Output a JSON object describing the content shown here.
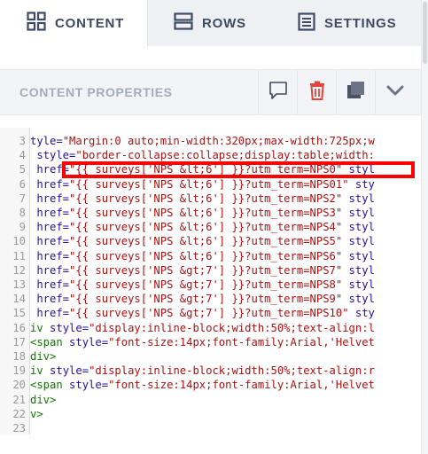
{
  "tabs": [
    {
      "label": "CONTENT",
      "icon": "grid-icon",
      "active": true
    },
    {
      "label": "ROWS",
      "icon": "rows-icon",
      "active": false
    },
    {
      "label": "SETTINGS",
      "icon": "settings-list-icon",
      "active": false
    }
  ],
  "properties_panel": {
    "title": "CONTENT PROPERTIES",
    "actions": [
      {
        "name": "comment-icon"
      },
      {
        "name": "trash-icon",
        "color": "#e0453a"
      },
      {
        "name": "duplicate-icon"
      },
      {
        "name": "chevron-down-icon"
      }
    ]
  },
  "editor": {
    "lines": [
      {
        "num": "3",
        "segments": [
          {
            "c": "k",
            "t": "tyle="
          },
          {
            "c": "s",
            "t": "\"Margin:0 auto;min-width:320px;max-width:725px;w"
          }
        ]
      },
      {
        "num": "4",
        "segments": [
          {
            "c": "k",
            "t": " style="
          },
          {
            "c": "s",
            "t": "\"border-collapse:collapse;display:table;width:"
          }
        ]
      },
      {
        "num": "5",
        "segments": [
          {
            "c": "k",
            "t": " href="
          },
          {
            "c": "s",
            "t": "\"{{ surveys['NPS &lt;6'] }}?utm_term=NPS0\""
          },
          {
            "c": "k",
            "t": " styl"
          }
        ]
      },
      {
        "num": "6",
        "segments": [
          {
            "c": "k",
            "t": " href="
          },
          {
            "c": "s",
            "t": "\"{{ surveys['NPS &lt;6'] }}?utm_term=NPS01\""
          },
          {
            "c": "k",
            "t": " sty"
          }
        ]
      },
      {
        "num": "7",
        "segments": [
          {
            "c": "k",
            "t": " href="
          },
          {
            "c": "s",
            "t": "\"{{ surveys['NPS &lt;6'] }}?utm_term=NPS2\""
          },
          {
            "c": "k",
            "t": " styl"
          }
        ]
      },
      {
        "num": "8",
        "segments": [
          {
            "c": "k",
            "t": " href="
          },
          {
            "c": "s",
            "t": "\"{{ surveys['NPS &lt;6'] }}?utm_term=NPS3\""
          },
          {
            "c": "k",
            "t": " styl"
          }
        ]
      },
      {
        "num": "9",
        "segments": [
          {
            "c": "k",
            "t": " href="
          },
          {
            "c": "s",
            "t": "\"{{ surveys['NPS &lt;6'] }}?utm_term=NPS4\""
          },
          {
            "c": "k",
            "t": " styl"
          }
        ]
      },
      {
        "num": "10",
        "segments": [
          {
            "c": "k",
            "t": " href="
          },
          {
            "c": "s",
            "t": "\"{{ surveys['NPS &lt;6'] }}?utm_term=NPS5\""
          },
          {
            "c": "k",
            "t": " styl"
          }
        ]
      },
      {
        "num": "11",
        "segments": [
          {
            "c": "k",
            "t": " href="
          },
          {
            "c": "s",
            "t": "\"{{ surveys['NPS &lt;6'] }}?utm_term=NPS6\""
          },
          {
            "c": "k",
            "t": " styl"
          }
        ]
      },
      {
        "num": "12",
        "segments": [
          {
            "c": "k",
            "t": " href="
          },
          {
            "c": "s",
            "t": "\"{{ surveys['NPS &gt;7'] }}?utm_term=NPS7\""
          },
          {
            "c": "k",
            "t": " styl"
          }
        ]
      },
      {
        "num": "13",
        "segments": [
          {
            "c": "k",
            "t": " href="
          },
          {
            "c": "s",
            "t": "\"{{ surveys['NPS &gt;7'] }}?utm_term=NPS8\""
          },
          {
            "c": "k",
            "t": " styl"
          }
        ]
      },
      {
        "num": "14",
        "segments": [
          {
            "c": "k",
            "t": " href="
          },
          {
            "c": "s",
            "t": "\"{{ surveys['NPS &gt;7'] }}?utm_term=NPS9\""
          },
          {
            "c": "k",
            "t": " styl"
          }
        ]
      },
      {
        "num": "15",
        "segments": [
          {
            "c": "k",
            "t": " href="
          },
          {
            "c": "s",
            "t": "\"{{ surveys['NPS &gt;7'] }}?utm_term=NPS10\""
          },
          {
            "c": "k",
            "t": " sty"
          }
        ]
      },
      {
        "num": "16",
        "segments": [
          {
            "c": "t",
            "t": "iv"
          },
          {
            "c": "k",
            "t": " style="
          },
          {
            "c": "s",
            "t": "\"display:inline-block;width:50%;text-align:l"
          }
        ]
      },
      {
        "num": "17",
        "segments": [
          {
            "c": "t",
            "t": "<span"
          },
          {
            "c": "k",
            "t": " style="
          },
          {
            "c": "s",
            "t": "\"font-size:14px;font-family:Arial,'Helvet"
          }
        ]
      },
      {
        "num": "18",
        "segments": [
          {
            "c": "t",
            "t": "div>"
          }
        ]
      },
      {
        "num": "19",
        "segments": [
          {
            "c": "t",
            "t": "iv"
          },
          {
            "c": "k",
            "t": " style="
          },
          {
            "c": "s",
            "t": "\"display:inline-block;width:50%;text-align:r"
          }
        ]
      },
      {
        "num": "20",
        "segments": [
          {
            "c": "t",
            "t": "<span"
          },
          {
            "c": "k",
            "t": " style="
          },
          {
            "c": "s",
            "t": "\"font-size:14px;font-family:Arial,'Helvet"
          }
        ]
      },
      {
        "num": "21",
        "segments": [
          {
            "c": "t",
            "t": "div>"
          }
        ]
      },
      {
        "num": "22",
        "segments": [
          {
            "c": "t",
            "t": "v>"
          }
        ]
      },
      {
        "num": "23",
        "segments": []
      }
    ]
  },
  "colors": {
    "keyword": "#221199",
    "string": "#aa1111",
    "tag": "#117700",
    "highlight": "#ff0000"
  }
}
